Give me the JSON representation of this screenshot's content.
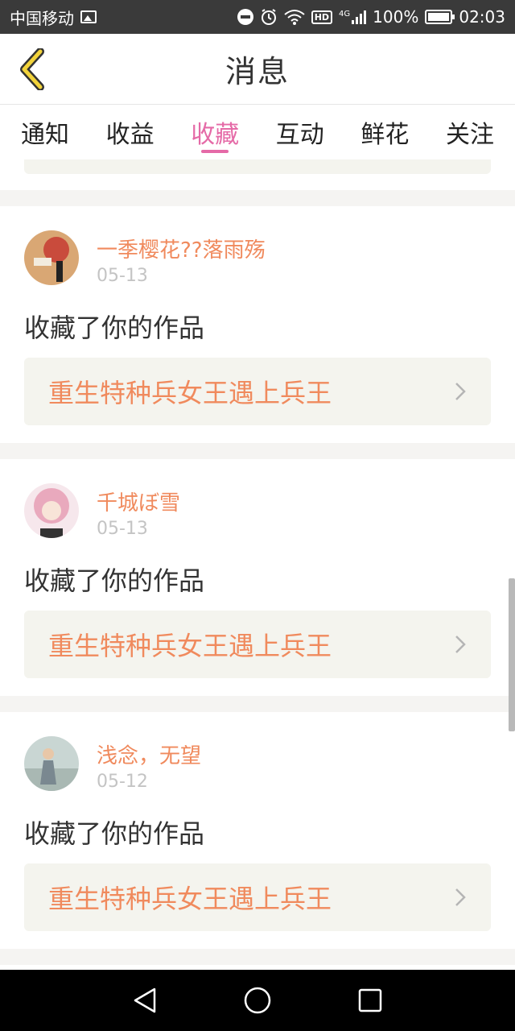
{
  "status_bar": {
    "carrier": "中国移动",
    "network": "4G",
    "hd": "HD",
    "battery": "100%",
    "time": "02:03"
  },
  "header": {
    "title": "消息"
  },
  "tabs": [
    {
      "label": "通知",
      "active": false
    },
    {
      "label": "收益",
      "active": false
    },
    {
      "label": "收藏",
      "active": true
    },
    {
      "label": "互动",
      "active": false
    },
    {
      "label": "鲜花",
      "active": false
    },
    {
      "label": "关注",
      "active": false
    }
  ],
  "messages": [
    {
      "name": "一季樱花??落雨殇",
      "date": "05-13",
      "action": "收藏了你的作品",
      "work": "重生特种兵女王遇上兵王"
    },
    {
      "name": "千城ぼ雪",
      "date": "05-13",
      "action": "收藏了你的作品",
      "work": "重生特种兵女王遇上兵王"
    },
    {
      "name": "浅念，无望",
      "date": "05-12",
      "action": "收藏了你的作品",
      "work": "重生特种兵女王遇上兵王"
    }
  ],
  "colors": {
    "accent_pink": "#e56aa7",
    "name_orange": "#f08a5d",
    "back_arrow": "#f2d33b"
  },
  "icons": {
    "back": "chevron-left-icon",
    "work_arrow": "chevron-right-icon",
    "nav_back": "triangle-back-icon",
    "nav_home": "circle-home-icon",
    "nav_recent": "square-recent-icon"
  }
}
